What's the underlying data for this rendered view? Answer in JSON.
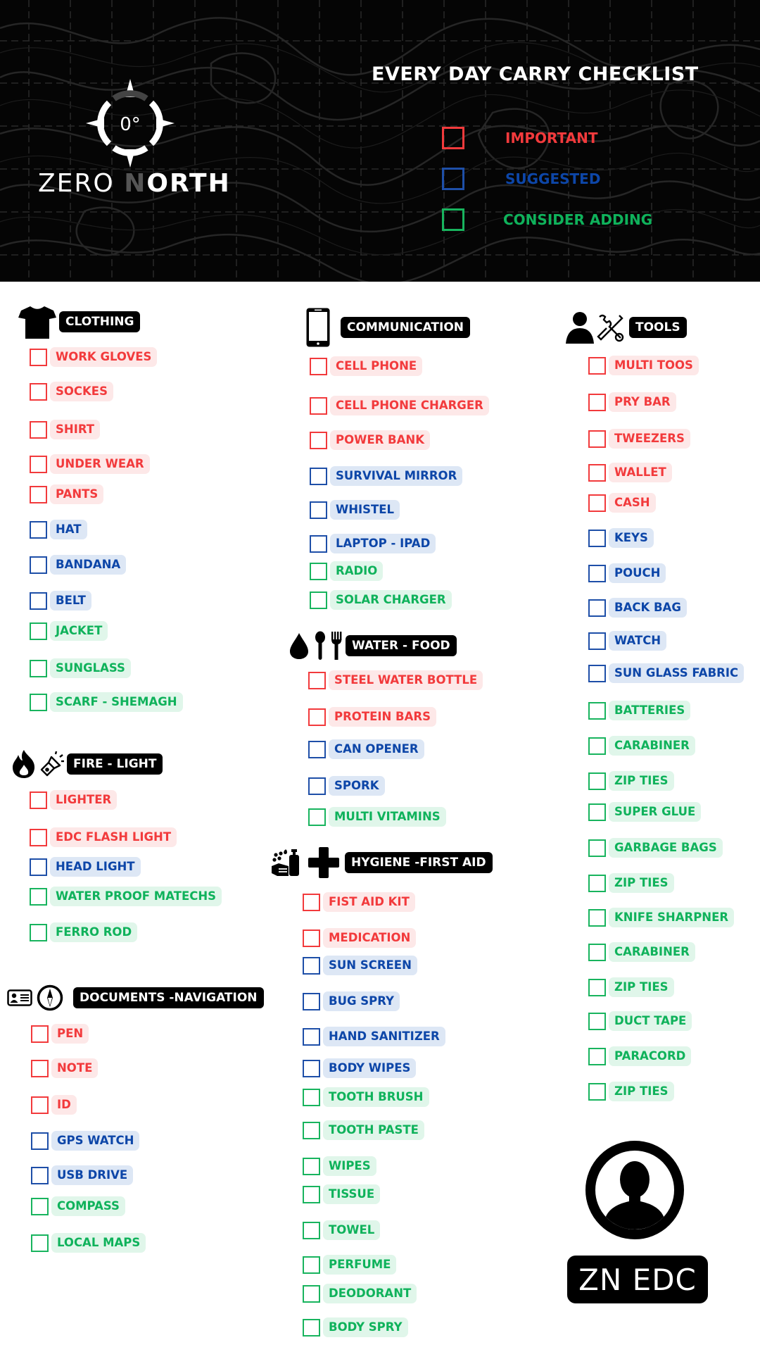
{
  "header": {
    "brand": {
      "part1": "ZERO ",
      "part2": "N",
      "part3": "ORTH",
      "logo_text": "0°"
    },
    "title": "EVERY DAY CARRY CHECKLIST",
    "legend": [
      {
        "label": "IMPORTANT",
        "priority": "important",
        "color": "#f23a3c"
      },
      {
        "label": "SUGGESTED",
        "priority": "suggested",
        "color": "#0d46a8"
      },
      {
        "label": "CONSIDER ADDING",
        "priority": "consider",
        "color": "#0fb25b"
      }
    ]
  },
  "colors": {
    "important": "#f23a3c",
    "suggested": "#0d46a8",
    "consider": "#0fb25b"
  },
  "sections": {
    "clothing": {
      "title": "CLOTHING",
      "icon": "tshirt-icon",
      "items": [
        {
          "label": "WORK GLOVES",
          "priority": "important"
        },
        {
          "label": "SOCKES",
          "priority": "important"
        },
        {
          "label": "SHIRT",
          "priority": "important"
        },
        {
          "label": "UNDER WEAR",
          "priority": "important"
        },
        {
          "label": "PANTS",
          "priority": "important"
        },
        {
          "label": "HAT",
          "priority": "suggested"
        },
        {
          "label": "BANDANA",
          "priority": "suggested"
        },
        {
          "label": "BELT",
          "priority": "suggested"
        },
        {
          "label": "JACKET",
          "priority": "consider"
        },
        {
          "label": "SUNGLASS",
          "priority": "consider"
        },
        {
          "label": "SCARF - SHEMAGH",
          "priority": "consider"
        }
      ]
    },
    "fire_light": {
      "title": "FIRE - LIGHT",
      "icons": [
        "fire-icon",
        "flashlight-icon"
      ],
      "items": [
        {
          "label": "LIGHTER",
          "priority": "important"
        },
        {
          "label": "EDC FLASH LIGHT",
          "priority": "important"
        },
        {
          "label": "HEAD LIGHT",
          "priority": "suggested"
        },
        {
          "label": "WATER PROOF MATECHS",
          "priority": "consider"
        },
        {
          "label": "FERRO ROD",
          "priority": "consider"
        }
      ]
    },
    "documents": {
      "title": "DOCUMENTS -NAVIGATION",
      "icons": [
        "id-card-icon",
        "compass-icon"
      ],
      "items": [
        {
          "label": "PEN",
          "priority": "important"
        },
        {
          "label": "NOTE",
          "priority": "important"
        },
        {
          "label": "ID",
          "priority": "important"
        },
        {
          "label": "GPS WATCH",
          "priority": "suggested"
        },
        {
          "label": "USB DRIVE",
          "priority": "suggested"
        },
        {
          "label": "COMPASS",
          "priority": "consider"
        },
        {
          "label": "LOCAL MAPS",
          "priority": "consider"
        }
      ]
    },
    "communication": {
      "title": "COMMUNICATION",
      "icon": "smartphone-icon",
      "items": [
        {
          "label": "CELL PHONE",
          "priority": "important"
        },
        {
          "label": "CELL PHONE CHARGER",
          "priority": "important"
        },
        {
          "label": "POWER BANK",
          "priority": "important"
        },
        {
          "label": "SURVIVAL MIRROR",
          "priority": "suggested"
        },
        {
          "label": "WHISTEL",
          "priority": "suggested"
        },
        {
          "label": "LAPTOP - IPAD",
          "priority": "suggested"
        },
        {
          "label": "RADIO",
          "priority": "consider"
        },
        {
          "label": "SOLAR CHARGER",
          "priority": "consider"
        }
      ]
    },
    "water_food": {
      "title": "WATER - FOOD",
      "icons": [
        "water-drop-icon",
        "spoon-icon",
        "fork-icon"
      ],
      "items": [
        {
          "label": "STEEL WATER BOTTLE",
          "priority": "important"
        },
        {
          "label": "PROTEIN BARS",
          "priority": "important"
        },
        {
          "label": "CAN OPENER",
          "priority": "suggested"
        },
        {
          "label": "SPORK",
          "priority": "suggested"
        },
        {
          "label": "MULTI VITAMINS",
          "priority": "consider"
        }
      ]
    },
    "hygiene": {
      "title": "HYGIENE -FIRST AID",
      "icons": [
        "hand-wash-icon",
        "medical-cross-icon"
      ],
      "items": [
        {
          "label": "FIST AID KIT",
          "priority": "important"
        },
        {
          "label": "MEDICATION",
          "priority": "important"
        },
        {
          "label": "SUN SCREEN",
          "priority": "suggested"
        },
        {
          "label": "BUG SPRY",
          "priority": "suggested"
        },
        {
          "label": "HAND SANITIZER",
          "priority": "suggested"
        },
        {
          "label": "BODY WIPES",
          "priority": "suggested"
        },
        {
          "label": "TOOTH BRUSH",
          "priority": "consider"
        },
        {
          "label": "TOOTH PASTE",
          "priority": "consider"
        },
        {
          "label": "WIPES",
          "priority": "consider"
        },
        {
          "label": "TISSUE",
          "priority": "consider"
        },
        {
          "label": "TOWEL",
          "priority": "consider"
        },
        {
          "label": "PERFUME",
          "priority": "consider"
        },
        {
          "label": "DEODORANT",
          "priority": "consider"
        },
        {
          "label": "BODY SPRY",
          "priority": "consider"
        }
      ]
    },
    "tools": {
      "title": "TOOLS",
      "icons": [
        "person-icon",
        "tools-icon"
      ],
      "items": [
        {
          "label": "MULTI TOOS",
          "priority": "important"
        },
        {
          "label": "PRY BAR",
          "priority": "important"
        },
        {
          "label": "TWEEZERS",
          "priority": "important"
        },
        {
          "label": "WALLET",
          "priority": "important"
        },
        {
          "label": "CASH",
          "priority": "important"
        },
        {
          "label": "KEYS",
          "priority": "suggested"
        },
        {
          "label": "POUCH",
          "priority": "suggested"
        },
        {
          "label": "BACK BAG",
          "priority": "suggested"
        },
        {
          "label": "WATCH",
          "priority": "suggested"
        },
        {
          "label": "SUN GLASS FABRIC",
          "priority": "suggested"
        },
        {
          "label": "BATTERIES",
          "priority": "consider"
        },
        {
          "label": "CARABINER",
          "priority": "consider"
        },
        {
          "label": "ZIP TIES",
          "priority": "consider"
        },
        {
          "label": "SUPER GLUE",
          "priority": "consider"
        },
        {
          "label": "GARBAGE BAGS",
          "priority": "consider"
        },
        {
          "label": "ZIP TIES",
          "priority": "consider"
        },
        {
          "label": "KNIFE SHARPNER",
          "priority": "consider"
        },
        {
          "label": "CARABINER",
          "priority": "consider"
        },
        {
          "label": "ZIP TIES",
          "priority": "consider"
        },
        {
          "label": "DUCT TAPE",
          "priority": "consider"
        },
        {
          "label": "PARACORD",
          "priority": "consider"
        },
        {
          "label": "ZIP TIES",
          "priority": "consider"
        }
      ]
    }
  },
  "footer": {
    "badge": "ZN EDC",
    "icon": "user-avatar-icon"
  }
}
